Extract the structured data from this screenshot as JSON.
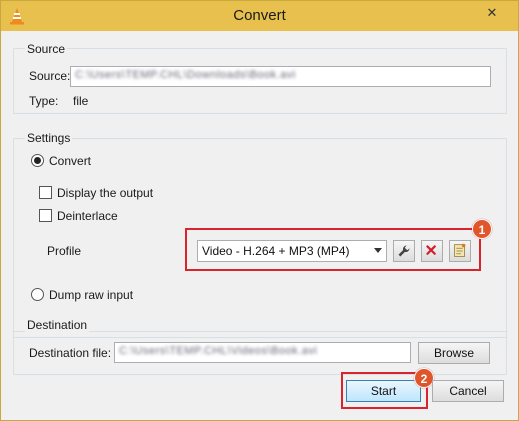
{
  "window": {
    "title": "Convert",
    "close_glyph": "✕",
    "app_icon": "vlc-cone-icon"
  },
  "source_group": {
    "title": "Source",
    "source_label": "Source:",
    "source_value": "C:\\Users\\TEMP.CHL\\Downloads\\Book.avi",
    "type_label": "Type:",
    "type_value": "file"
  },
  "settings_group": {
    "title": "Settings",
    "convert_label": "Convert",
    "convert_selected": true,
    "display_output_label": "Display the output",
    "display_output_checked": false,
    "deinterlace_label": "Deinterlace",
    "deinterlace_checked": false,
    "profile_label": "Profile",
    "profile_value": "Video - H.264 + MP3 (MP4)",
    "profile_tools": [
      "wrench-icon",
      "delete-x-icon",
      "new-profile-icon"
    ],
    "dump_raw_label": "Dump raw input",
    "dump_raw_selected": false
  },
  "destination_group": {
    "title": "Destination",
    "dest_label": "Destination file:",
    "dest_value": "C:\\Users\\TEMP.CHL\\Videos\\Book.avi",
    "browse_label": "Browse"
  },
  "footer": {
    "start_label": "Start",
    "cancel_label": "Cancel"
  },
  "annotations": {
    "badge_1": "1",
    "badge_2": "2",
    "highlight_color": "#d9232d",
    "badge_color": "#e0562a"
  },
  "colors": {
    "titlebar": "#e8c04e",
    "client": "#f0f0f0",
    "start_button_bg": "#bee6fd"
  }
}
